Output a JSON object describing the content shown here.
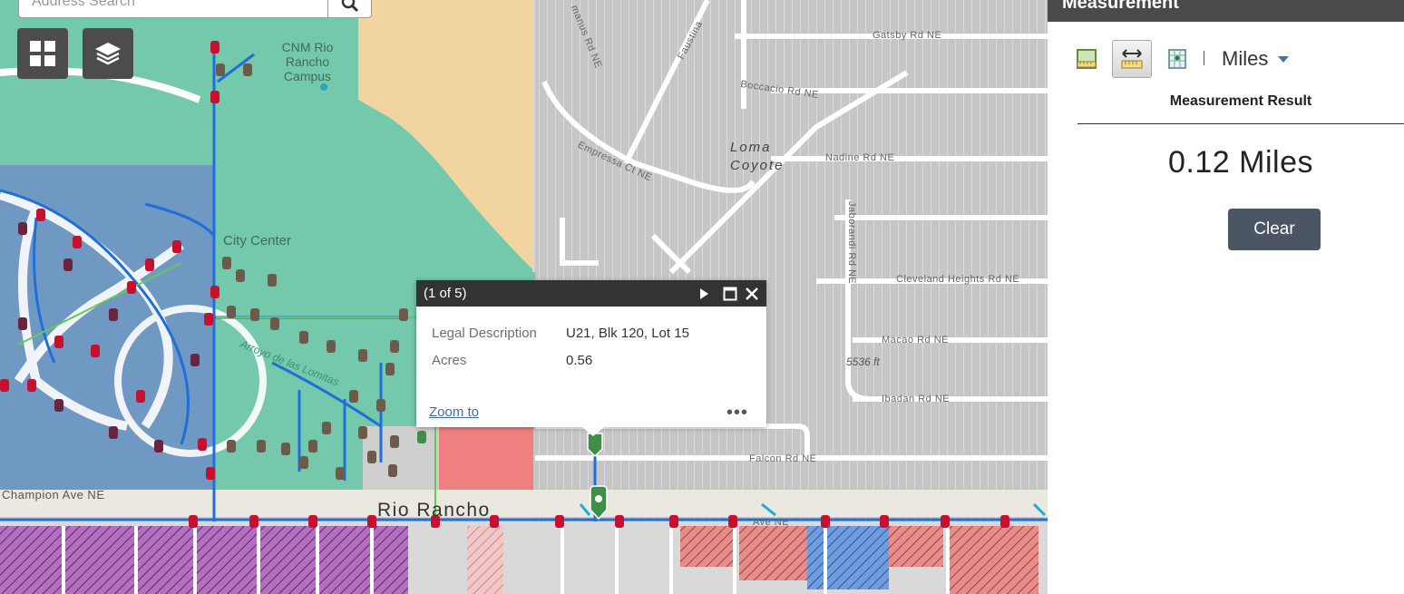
{
  "search": {
    "placeholder": "Address Search"
  },
  "map_controls": {
    "basemap_icon": "grid-icon",
    "layers_icon": "layers-icon"
  },
  "map_labels": {
    "campus": "CNM Rio Rancho Campus",
    "city_center": "City Center",
    "loma_coyote": "Loma Coyote",
    "rio_rancho": "Rio Rancho",
    "arroyo": "Arroyo de las Lomitas",
    "elevation": "5536 ft"
  },
  "streets": {
    "gatsby": "Gatsby Rd NE",
    "boccacio": "Boccacio Rd NE",
    "nadine": "Nadine Rd NE",
    "empressa": "Empressa Ct NE",
    "cleveland": "Cleveland Heights Rd NE",
    "macao": "Macao Rd NE",
    "ibadan": "Ibadan Rd NE",
    "falcon": "Falcon Rd NE",
    "champion": "Champion Ave NE",
    "faustina": "Faustina",
    "jaborandi": "Jaborandi Rd NE",
    "manus": "manus Rd NE",
    "ave": "Ave NE"
  },
  "popup": {
    "count": "(1 of 5)",
    "fields": [
      {
        "label": "Legal Description",
        "value": "U21, Blk 120, Lot 15"
      },
      {
        "label": "Acres",
        "value": "0.56"
      }
    ],
    "zoom_label": "Zoom to",
    "more_label": "•••"
  },
  "panel": {
    "title": "Measurement",
    "unit": "Miles",
    "result_label": "Measurement Result",
    "result_value": "0.12 Miles",
    "clear_label": "Clear"
  },
  "colors": {
    "header": "#4a4a4a",
    "clear_button": "#4c5563",
    "water_line": "#1e6fd9",
    "hydrant": "#c8102e",
    "zone_green": "#74c8ab"
  }
}
